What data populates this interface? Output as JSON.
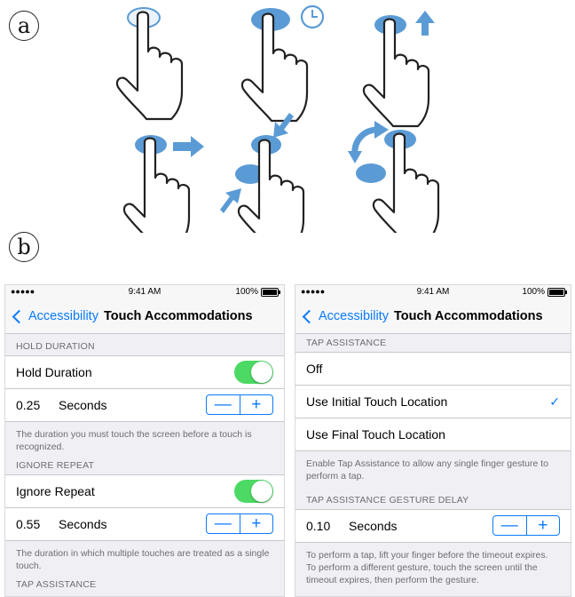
{
  "labels": {
    "a": "a",
    "b": "b"
  },
  "status": {
    "signal": "●●●●● ",
    "time": "9:41 AM",
    "battery": "100%"
  },
  "left_phone": {
    "back_label": "Accessibility",
    "title": "Touch Accommodations",
    "hold_header": "HOLD DURATION",
    "hold_label": "Hold Duration",
    "hold_value": "0.25",
    "hold_unit": "Seconds",
    "hold_footer": "The duration you must touch the screen before a touch is recognized.",
    "ignore_header": "IGNORE REPEAT",
    "ignore_label": "Ignore Repeat",
    "ignore_value": "0.55",
    "ignore_unit": "Seconds",
    "ignore_footer": "The duration in which multiple touches are treated as a single touch.",
    "tap_header": "TAP ASSISTANCE"
  },
  "right_phone": {
    "back_label": "Accessibility",
    "title": "Touch Accommodations",
    "tap_header": "TAP ASSISTANCE",
    "options": [
      "Off",
      "Use Initial Touch Location",
      "Use Final Touch Location"
    ],
    "selected_index": 1,
    "tap_footer": "Enable Tap Assistance to allow any single finger gesture to perform a tap.",
    "delay_header": "TAP ASSISTANCE GESTURE DELAY",
    "delay_value": "0.10",
    "delay_unit": "Seconds",
    "delay_footer": "To perform a tap, lift your finger before the timeout expires. To perform a different gesture, touch the screen until the timeout expires, then perform the gesture."
  },
  "stepper": {
    "minus": "—",
    "plus": "+"
  },
  "colors": {
    "accent": "#0a7aff",
    "toggle_on": "#4cd964",
    "gesture_blue": "#5b9bd5"
  },
  "icons": [
    "tap-hand-icon",
    "hold-hand-icon",
    "swipe-up-hand-icon",
    "swipe-right-hand-icon",
    "pinch-hand-icon",
    "rotate-hand-icon"
  ]
}
